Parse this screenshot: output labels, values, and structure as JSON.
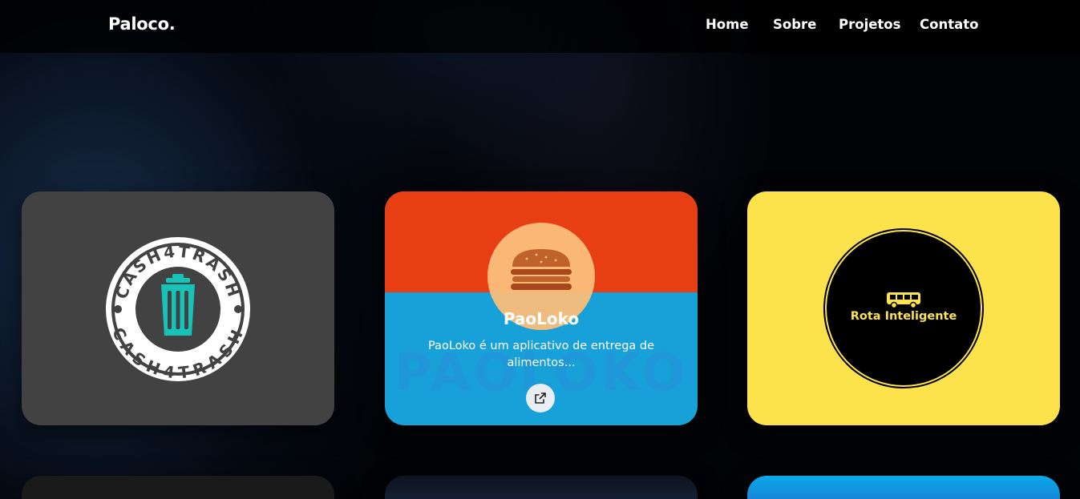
{
  "navbar": {
    "brand": "Paloco.",
    "links": [
      {
        "label": "Home"
      },
      {
        "label": "Sobre"
      },
      {
        "label": "Projetos"
      },
      {
        "label": "Contato"
      }
    ]
  },
  "projects": [
    {
      "logo_text": "CASH4TRASH",
      "icon": "trash-icon",
      "color": "#424242",
      "accent": "#17c3b8"
    },
    {
      "title": "PaoLoko",
      "description": "PaoLoko é um aplicativo de entrega de alimentos...",
      "watermark": "PAOLOKO",
      "icon": "burger-icon",
      "link_icon": "external-link-icon",
      "colors": {
        "top": "#e83e14",
        "bottom": "#18a0d8"
      }
    },
    {
      "logo_text": "Rota Inteligente",
      "icon": "bus-icon",
      "color": "#fde34b"
    }
  ],
  "colors": {
    "background": "#020306",
    "navbar": "#000000",
    "text": "#ffffff"
  }
}
